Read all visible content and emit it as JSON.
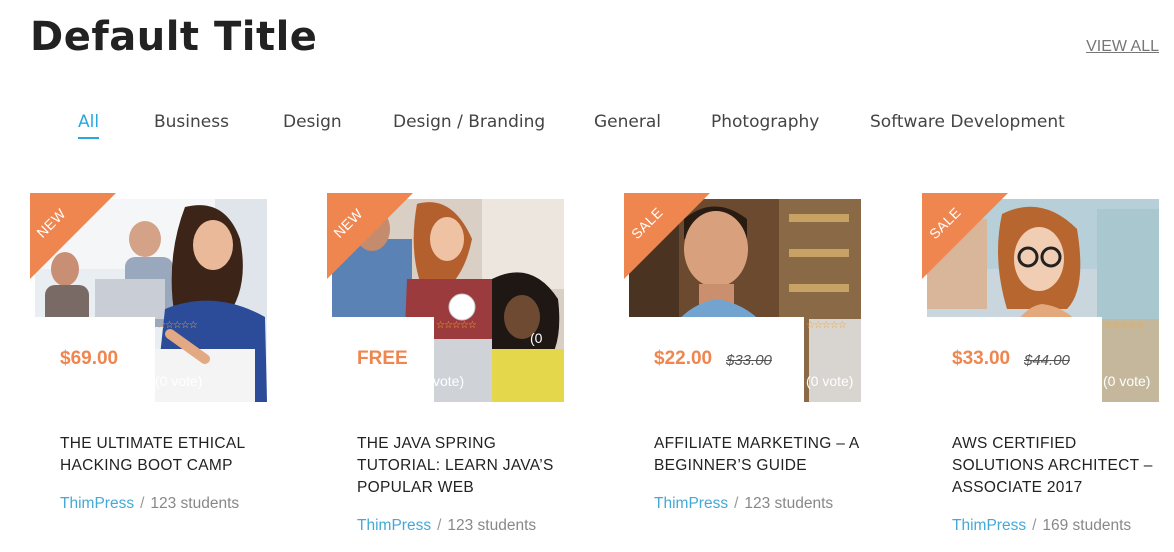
{
  "page": {
    "title": "Default Title",
    "view_all": "VIEW ALL"
  },
  "tabs": [
    "All",
    "Business",
    "Design",
    "Design / Branding",
    "General",
    "Photography",
    "Software Development"
  ],
  "rating_stars": "☆☆☆☆☆",
  "separator": "/",
  "colors": {
    "accent": "#29a8df",
    "ribbon": "#f0864f",
    "price": "#f0864f",
    "author": "#45a9d6"
  },
  "courses": [
    {
      "badge": "NEW",
      "price": "$69.00",
      "old_price": "",
      "vote": "(0 vote)",
      "title": "THE ULTIMATE ETHICAL HACKING BOOT CAMP",
      "author": "ThimPress",
      "students": "123 students"
    },
    {
      "badge": "NEW",
      "price": "FREE",
      "old_price": "",
      "vote": "vote)",
      "vote_top": "(0",
      "title": "THE JAVA SPRING TUTORIAL: LEARN JAVA’S POPULAR WEB",
      "author": "ThimPress",
      "students": "123 students"
    },
    {
      "badge": "SALE",
      "price": "$22.00",
      "old_price": "$33.00",
      "vote": "(0 vote)",
      "title": "AFFILIATE MARKETING – A BEGINNER’S GUIDE",
      "author": "ThimPress",
      "students": "123 students"
    },
    {
      "badge": "SALE",
      "price": "$33.00",
      "old_price": "$44.00",
      "vote": "(0 vote)",
      "title": "AWS CERTIFIED SOLUTIONS ARCHITECT – ASSOCIATE 2017",
      "author": "ThimPress",
      "students": "169 students"
    }
  ]
}
